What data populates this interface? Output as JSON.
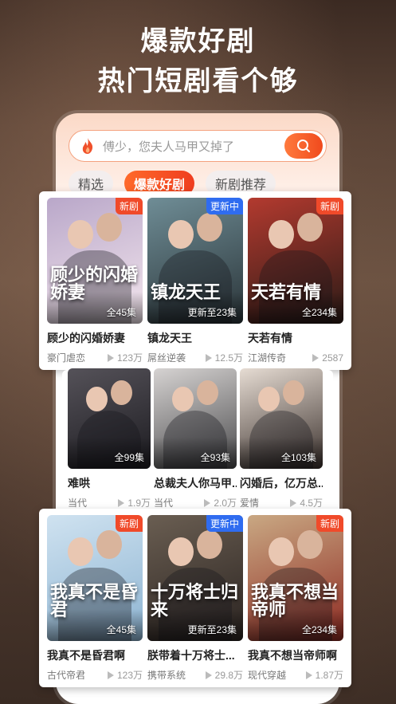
{
  "headline": {
    "line1": "爆款好剧",
    "line2": "热门短剧看个够"
  },
  "search": {
    "placeholder": "傅少，您夫人马甲又掉了"
  },
  "tabs": [
    {
      "label": "精选",
      "active": false
    },
    {
      "label": "爆款好剧",
      "active": true
    },
    {
      "label": "新剧推荐",
      "active": false
    }
  ],
  "rows": [
    {
      "items": [
        {
          "title": "顾少的闪婚娇妻",
          "poster_text": "顾少的闪婚娇妻",
          "count": "全45集",
          "badge": "新剧",
          "badge_type": "new",
          "tag": "豪门虐恋",
          "views": "123万",
          "colors": [
            "#b9a7c9",
            "#f4e7ee"
          ]
        },
        {
          "title": "镇龙天王",
          "poster_text": "镇龙天王",
          "count": "更新至23集",
          "badge": "更新中",
          "badge_type": "upd",
          "tag": "屌丝逆袭",
          "views": "12.5万",
          "colors": [
            "#6f8d96",
            "#2a3438"
          ]
        },
        {
          "title": "天若有情",
          "poster_text": "天若有情",
          "count": "全234集",
          "badge": "新剧",
          "badge_type": "new",
          "tag": "江湖传奇",
          "views": "2587",
          "colors": [
            "#b33a2f",
            "#2a1a16"
          ]
        }
      ]
    },
    {
      "items": [
        {
          "title": "难哄",
          "poster_text": "",
          "count": "全99集",
          "badge": "",
          "badge_type": "",
          "tag": "当代",
          "views": "1.9万",
          "colors": [
            "#555259",
            "#1c1b20"
          ]
        },
        {
          "title": "总裁夫人你马甲...",
          "poster_text": "",
          "count": "全93集",
          "badge": "",
          "badge_type": "",
          "tag": "当代",
          "views": "2.0万",
          "colors": [
            "#d6d3d2",
            "#4a4a4c"
          ]
        },
        {
          "title": "闪婚后，亿万总...",
          "poster_text": "",
          "count": "全103集",
          "badge": "",
          "badge_type": "",
          "tag": "爱情",
          "views": "4.5万",
          "colors": [
            "#e6dcd3",
            "#3a302c"
          ]
        }
      ]
    },
    {
      "items": [
        {
          "title": "我真不是昏君啊",
          "poster_text": "我真不是昏君",
          "count": "全45集",
          "badge": "新剧",
          "badge_type": "new",
          "tag": "古代帝君",
          "views": "123万",
          "colors": [
            "#cfe2f0",
            "#8db4d2"
          ]
        },
        {
          "title": "朕带着十万将士...",
          "poster_text": "十万将士归来",
          "count": "更新至23集",
          "badge": "更新中",
          "badge_type": "upd",
          "tag": "携带系统",
          "views": "29.8万",
          "colors": [
            "#6a5e52",
            "#2a2320"
          ]
        },
        {
          "title": "我真不想当帝师啊",
          "poster_text": "我真不想当帝师",
          "count": "全234集",
          "badge": "新剧",
          "badge_type": "new",
          "tag": "现代穿越",
          "views": "1.87万",
          "colors": [
            "#c9a883",
            "#8e2a22"
          ]
        }
      ]
    }
  ]
}
